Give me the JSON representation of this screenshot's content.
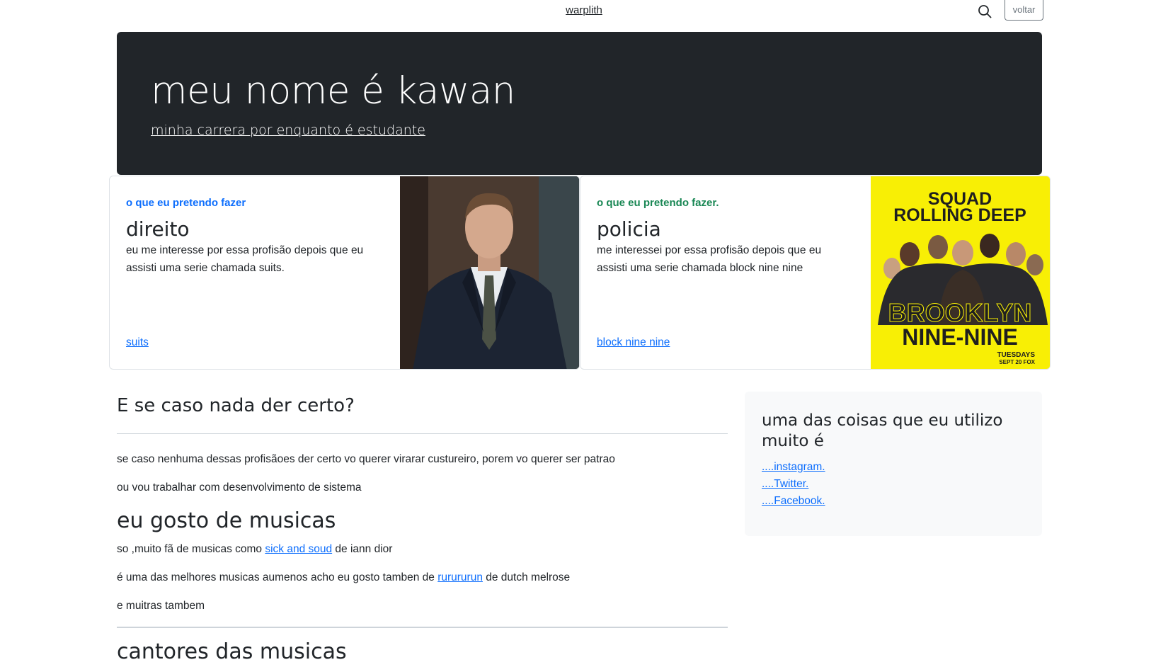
{
  "header": {
    "brand": "warplith",
    "back_label": "voltar",
    "search_icon": "search-icon"
  },
  "hero": {
    "title": "meu nome é kawan",
    "subtitle": "minha carrera por enquanto é estudante"
  },
  "cards": [
    {
      "kicker": "o que eu pretendo fazer",
      "title": "direito",
      "description": "eu me interesse por essa profisão depois que eu assisti uma serie chamada suits.",
      "link": "suits",
      "image": "suits-actor-photo"
    },
    {
      "kicker": "o que eu pretendo fazer.",
      "title": "policia",
      "description": "me interessei por essa profisão depois que eu assisti uma serie chamada block nine nine",
      "link": "block nine nine",
      "image": "brooklyn-nine-nine-poster",
      "poster_text": {
        "top_line1": "SQUAD",
        "top_line2": "ROLLING DEEP",
        "bottom_line1": "BROOKLYN",
        "bottom_line2": "NINE-NINE",
        "date_line1": "TUESDAYS",
        "date_line2": "SEPT 20 FOX"
      }
    }
  ],
  "main": {
    "heading_fail": "E se caso nada der certo?",
    "para1": "se caso nenhuma dessas profisãoes der certo vo querer virarar custureiro, porem vo querer ser patrao",
    "para2": "ou vou trabalhar com desenvolvimento de sistema",
    "heading_music": "eu gosto de musicas",
    "music_line1_pre": "so ,muito fã de musicas como ",
    "music_line1_link": "sick and soud",
    "music_line1_post": " de iann dior",
    "music_line2_pre": "é uma das melhores musicas aumenos acho eu gosto tamben de ",
    "music_line2_link": "rurururun",
    "music_line2_post": " de dutch melrose",
    "music_line3": "e muitras tambem",
    "heading_singers": "cantores das musicas"
  },
  "aside": {
    "title": "uma das coisas que eu utilizo muito é",
    "links": [
      "....instagram.",
      "....Twitter.",
      "....Facebook."
    ]
  }
}
